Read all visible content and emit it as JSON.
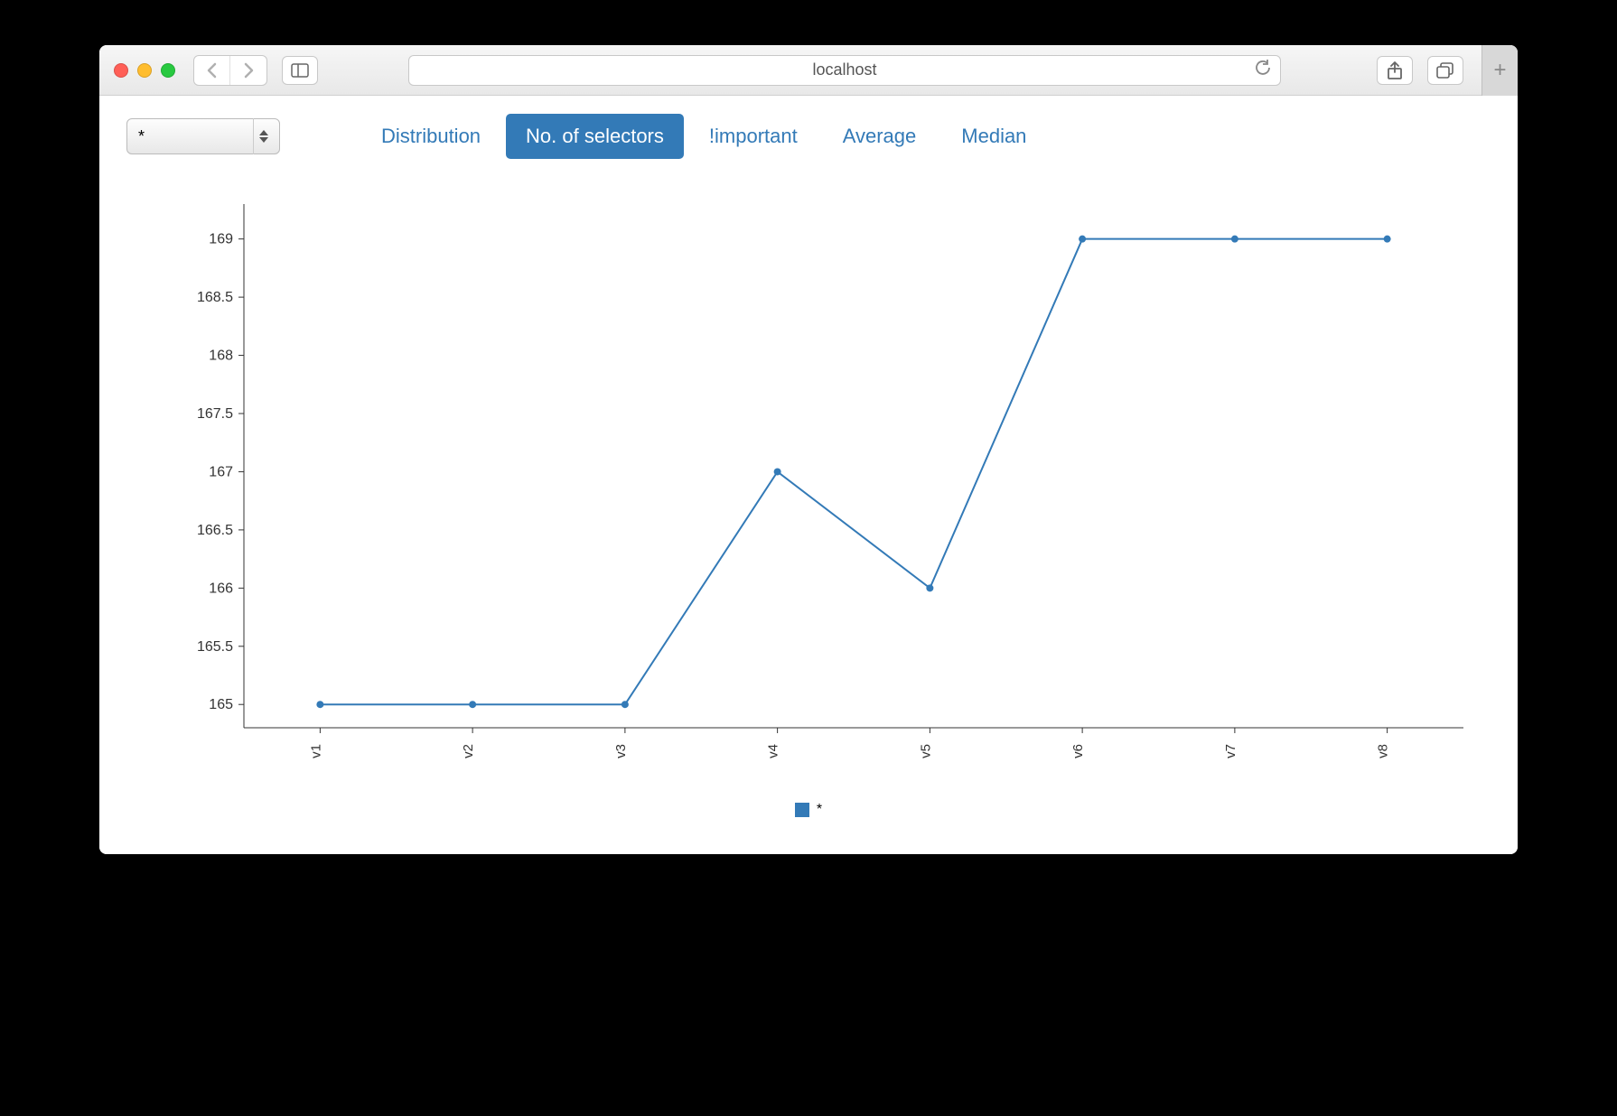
{
  "browser": {
    "address": "localhost"
  },
  "toolbar": {
    "selector_value": "*",
    "tabs": [
      {
        "label": "Distribution",
        "active": false
      },
      {
        "label": "No. of selectors",
        "active": true
      },
      {
        "label": "!important",
        "active": false
      },
      {
        "label": "Average",
        "active": false
      },
      {
        "label": "Median",
        "active": false
      }
    ]
  },
  "legend": {
    "label": "*"
  },
  "chart_data": {
    "type": "line",
    "categories": [
      "v1",
      "v2",
      "v3",
      "v4",
      "v5",
      "v6",
      "v7",
      "v8"
    ],
    "series": [
      {
        "name": "*",
        "values": [
          165,
          165,
          165,
          167,
          166,
          169,
          169,
          169
        ]
      }
    ],
    "y_ticks": [
      165,
      165.5,
      166,
      166.5,
      167,
      167.5,
      168,
      168.5,
      169
    ],
    "ylim": [
      164.8,
      169.3
    ],
    "xlabel": "",
    "ylabel": "",
    "title": ""
  }
}
